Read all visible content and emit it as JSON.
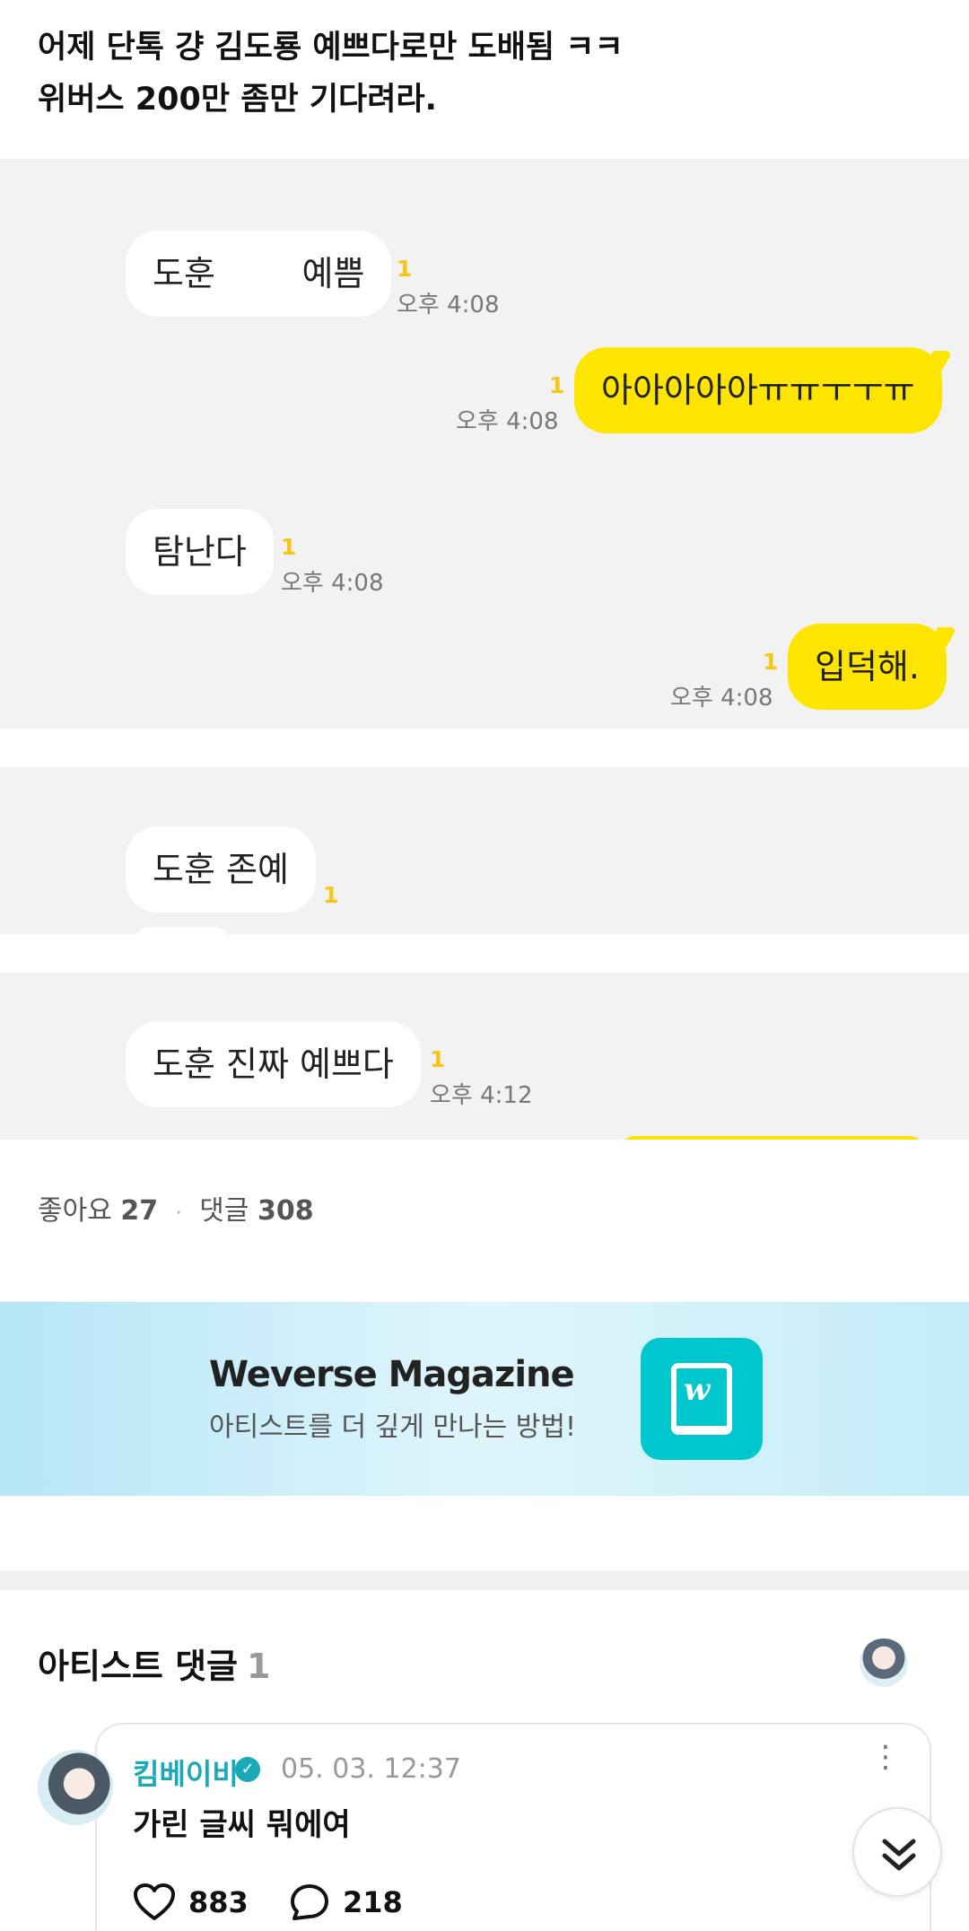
{
  "post": {
    "line1": "어제 단톡 걍 김도룡 예쁘다로만 도배됨 ㅋㅋ",
    "line2": "위버스 200만 좀만 기다려라."
  },
  "chat1": {
    "msg1": {
      "text": "도훈        예쁨",
      "unread": "1",
      "time": "오후 4:08"
    },
    "msg2": {
      "text": "아아아아아ㅠㅠㅜㅜㅠ",
      "unread": "1",
      "time": "오후 4:08"
    },
    "msg3": {
      "text": "탐난다",
      "unread": "1",
      "time": "오후 4:08"
    },
    "msg4": {
      "text": "입덕해.",
      "unread": "1",
      "time": "오후 4:08"
    }
  },
  "chat2": {
    "msg1": {
      "text": "도훈 존예",
      "unread": "1"
    }
  },
  "chat3": {
    "msg1": {
      "text": "도훈 진짜 예쁘다",
      "unread": "1",
      "time": "오후 4:12"
    }
  },
  "stats": {
    "likes_label": "좋아요",
    "likes_count": "27",
    "separator": "·",
    "comments_label": "댓글",
    "comments_count": "308"
  },
  "banner": {
    "title": "Weverse Magazine",
    "subtitle": "아티스트를 더 깊게 만나는 방법!",
    "icon": "weverse-magazine-logo",
    "logo_letter": "w",
    "accent": "#00c7ce"
  },
  "artist_comments": {
    "title": "아티스트 댓글",
    "count": "1"
  },
  "comment": {
    "author": "킴베이비",
    "verified_icon": "verified-check-icon",
    "verified_glyph": "✓",
    "date": "05. 03. 12:37",
    "more_glyph": "⋮",
    "text": "가린 글씨 뭐에여",
    "likes": "883",
    "replies": "218",
    "name_color": "#1aa9b8"
  },
  "colors": {
    "kakao_yellow": "#fee500",
    "chat_bg": "#f2f2f2"
  }
}
